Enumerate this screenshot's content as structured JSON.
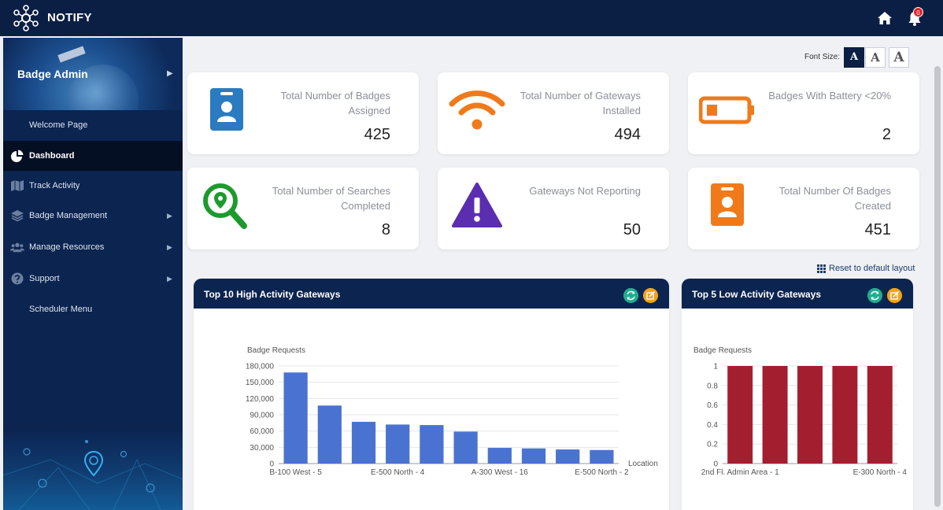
{
  "app": {
    "title": "NOTIFY",
    "notification_count": "0"
  },
  "sidebar": {
    "title": "Badge Admin",
    "items": [
      {
        "label": "Welcome Page",
        "icon": "none"
      },
      {
        "label": "Dashboard",
        "icon": "pie-chart-icon",
        "active": true
      },
      {
        "label": "Track Activity",
        "icon": "map-icon"
      },
      {
        "label": "Badge Management",
        "icon": "layers-icon"
      },
      {
        "label": "Manage Resources",
        "icon": "users-icon"
      },
      {
        "label": "Support",
        "icon": "question-icon"
      },
      {
        "label": "Scheduler Menu",
        "icon": "none"
      }
    ]
  },
  "font_size": {
    "label": "Font Size:",
    "options": [
      "A",
      "A",
      "A"
    ]
  },
  "cards": [
    {
      "title": "Total Number of Badges Assigned",
      "value": "425",
      "icon": "badge-icon",
      "color": "#2a7bc0"
    },
    {
      "title": "Total Number of Gateways Installed",
      "value": "494",
      "icon": "wifi-icon",
      "color": "#f07a1a"
    },
    {
      "title": "Badges With Battery <20%",
      "value": "2",
      "icon": "battery-low-icon",
      "color": "#f07a1a"
    },
    {
      "title": "Total Number of Searches Completed",
      "value": "8",
      "icon": "location-search-icon",
      "color": "#1d9a2e"
    },
    {
      "title": "Gateways Not Reporting",
      "value": "50",
      "icon": "warning-icon",
      "color": "#5b2db0"
    },
    {
      "title": "Total Number Of Badges Created",
      "value": "451",
      "icon": "badge-icon",
      "color": "#f07a1a"
    }
  ],
  "reset_link": "Reset to default layout",
  "panels": {
    "high": {
      "title": "Top 10 High Activity Gateways"
    },
    "low": {
      "title": "Top 5 Low Activity Gateways"
    }
  },
  "chart_data": [
    {
      "type": "bar",
      "ylabel": "Badge Requests",
      "xlabel": "Location",
      "ylim": [
        0,
        180000
      ],
      "yticks": [
        "0",
        "30,000",
        "60,000",
        "90,000",
        "120,000",
        "150,000",
        "180,000"
      ],
      "x_tick_labels": [
        "B-100 West - 5",
        "E-500 North - 4",
        "A-300 West - 16",
        "E-500 North - 2"
      ],
      "values": [
        168000,
        107000,
        77000,
        72000,
        71000,
        59000,
        29000,
        28000,
        26000,
        25000
      ],
      "color": "#4a73d1",
      "grid": true
    },
    {
      "type": "bar",
      "ylabel": "Badge Requests",
      "ylim": [
        0,
        1
      ],
      "yticks": [
        "0",
        "0.2",
        "0.4",
        "0.6",
        "0.8",
        "1"
      ],
      "x_tick_labels": [
        "2nd Fl. Admin Area - 1",
        "E-300 North - 4"
      ],
      "values": [
        1,
        1,
        1,
        1,
        1
      ],
      "color": "#a31f2f",
      "grid": true
    }
  ]
}
